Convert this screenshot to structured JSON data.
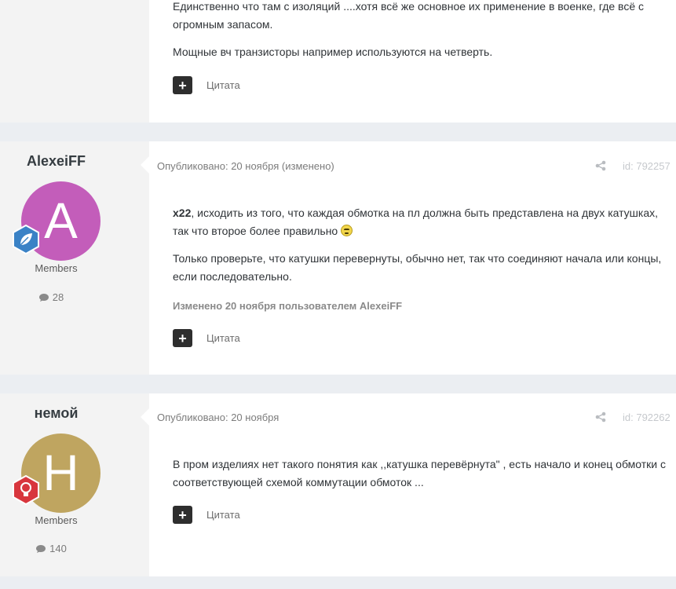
{
  "top_post": {
    "lines": [
      "Единственно что там с изоляций ....хотя всё же основное их применение в военке, где всё с огромным запасом.",
      "Мощные вч транзисторы  например используются на четверть."
    ],
    "quote_label": "Цитата"
  },
  "posts": [
    {
      "author": "AlexeiFF",
      "avatar_letter": "A",
      "avatar_color": "#c35dba",
      "badge_color": "#3a82c6",
      "badge_icon": "leaf-icon",
      "group": "Members",
      "post_count": "28",
      "meta": "Опубликовано: 20 ноября (изменено)",
      "post_id": "id: 792257",
      "mention": "x22",
      "para1_rest": ", исходить из того, что каждая обмотка на пл должна быть представлена на двух катушках, так что второе более правильно ",
      "para2": "Только проверьте, что катушки перевернуты, обычно нет, так что соединяют начала или концы, если последовательно.",
      "edited_note": "Изменено 20 ноября пользователем AlexeiFF",
      "quote_label": "Цитата"
    },
    {
      "author": "немой",
      "avatar_letter": "Н",
      "avatar_color": "#bfa560",
      "badge_color": "#d8363d",
      "badge_icon": "lightbulb-icon",
      "group": "Members",
      "post_count": "140",
      "meta": "Опубликовано: 20 ноября",
      "post_id": "id: 792262",
      "para1": "В пром изделиях нет такого понятия как ,,катушка перевёрнута\" , есть начало и конец обмотки с соответствующей схемой коммутации обмоток ...",
      "quote_label": "Цитата"
    }
  ]
}
